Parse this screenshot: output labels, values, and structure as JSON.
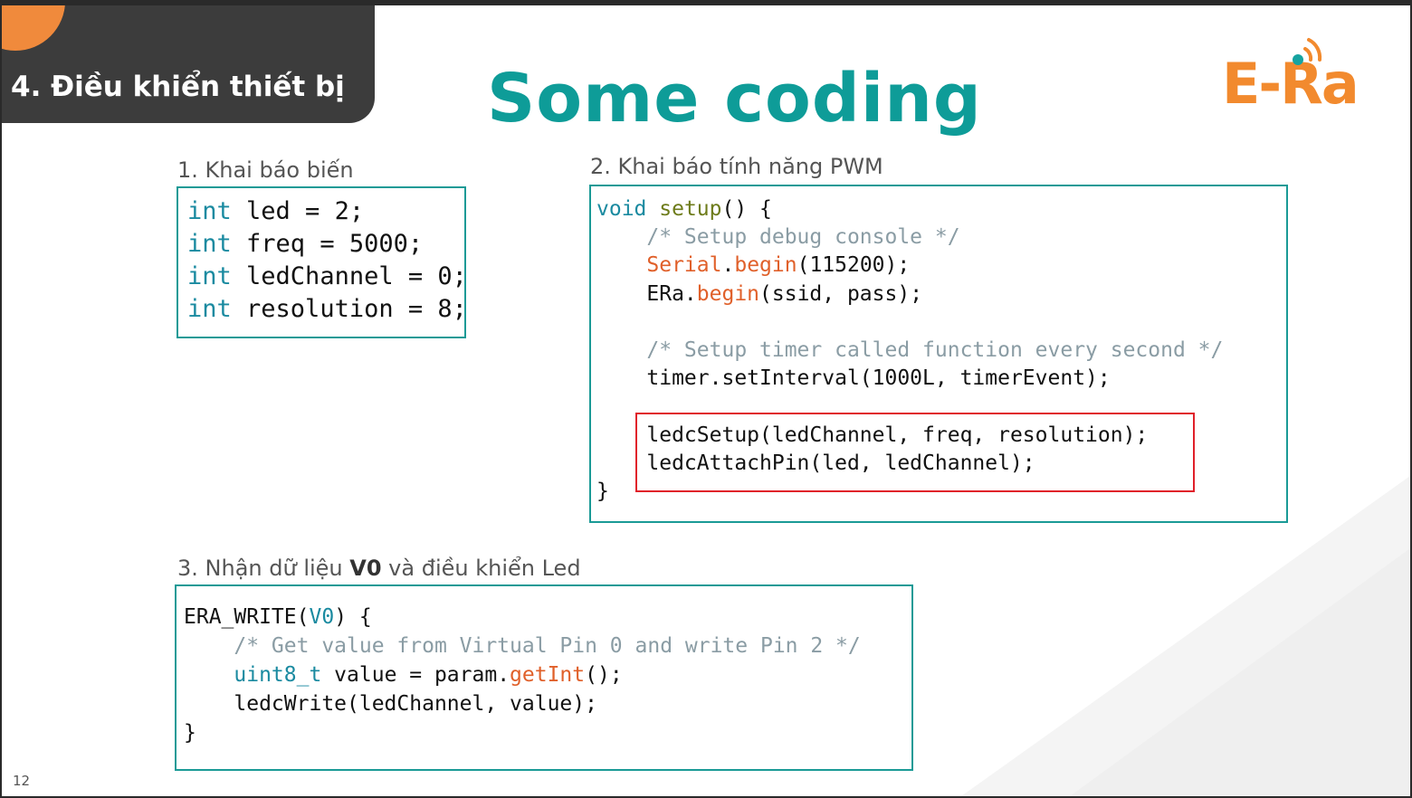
{
  "header": {
    "section_title": "4. Điều khiển thiết bị",
    "title": "Some coding",
    "logo_text": "E-Ra"
  },
  "section1": {
    "label": "1. Khai báo biến",
    "lines": [
      {
        "kw": "int",
        "rest": " led = 2;"
      },
      {
        "kw": "int",
        "rest": " freq = 5000;"
      },
      {
        "kw": "int",
        "rest": " ledChannel = 0;"
      },
      {
        "kw": "int",
        "rest": " resolution = 8;"
      }
    ]
  },
  "section2": {
    "label": "2. Khai báo tính năng PWM",
    "l1_kw": "void",
    "l1_fn": "setup",
    "l1_rest": "() {",
    "l2_comment": "/* Setup debug console */",
    "l3_obj": "Serial",
    "l3_dot": ".",
    "l3_fn": "begin",
    "l3_rest": "(115200);",
    "l4_obj": "ERa.",
    "l4_fn": "begin",
    "l4_rest": "(ssid, pass);",
    "l5_comment": "/* Setup timer called function every second */",
    "l6": "timer.setInterval(1000L, timerEvent);",
    "l7": "ledcSetup(ledChannel, freq, resolution);",
    "l8": "ledcAttachPin(led, ledChannel);",
    "l9": "}"
  },
  "section3": {
    "label_pre": "3. Nhận dữ liệu ",
    "label_bold": "V0",
    "label_post": " và điều khiển Led",
    "l1_pre": "ERA_WRITE(",
    "l1_kw": "V0",
    "l1_post": ") {",
    "l2_comment": "/* Get value from Virtual Pin 0 and write Pin 2 */",
    "l3_kw": "uint8_t",
    "l3_mid": " value = param.",
    "l3_fn": "getInt",
    "l3_rest": "();",
    "l4": "ledcWrite(ledChannel, value);",
    "l5": "}"
  },
  "footer": {
    "page_number": "12"
  },
  "colors": {
    "teal": "#0e9c98",
    "orange": "#f28a2e",
    "dark_tab": "#3c3c3c",
    "highlight_red": "#e0202a"
  }
}
